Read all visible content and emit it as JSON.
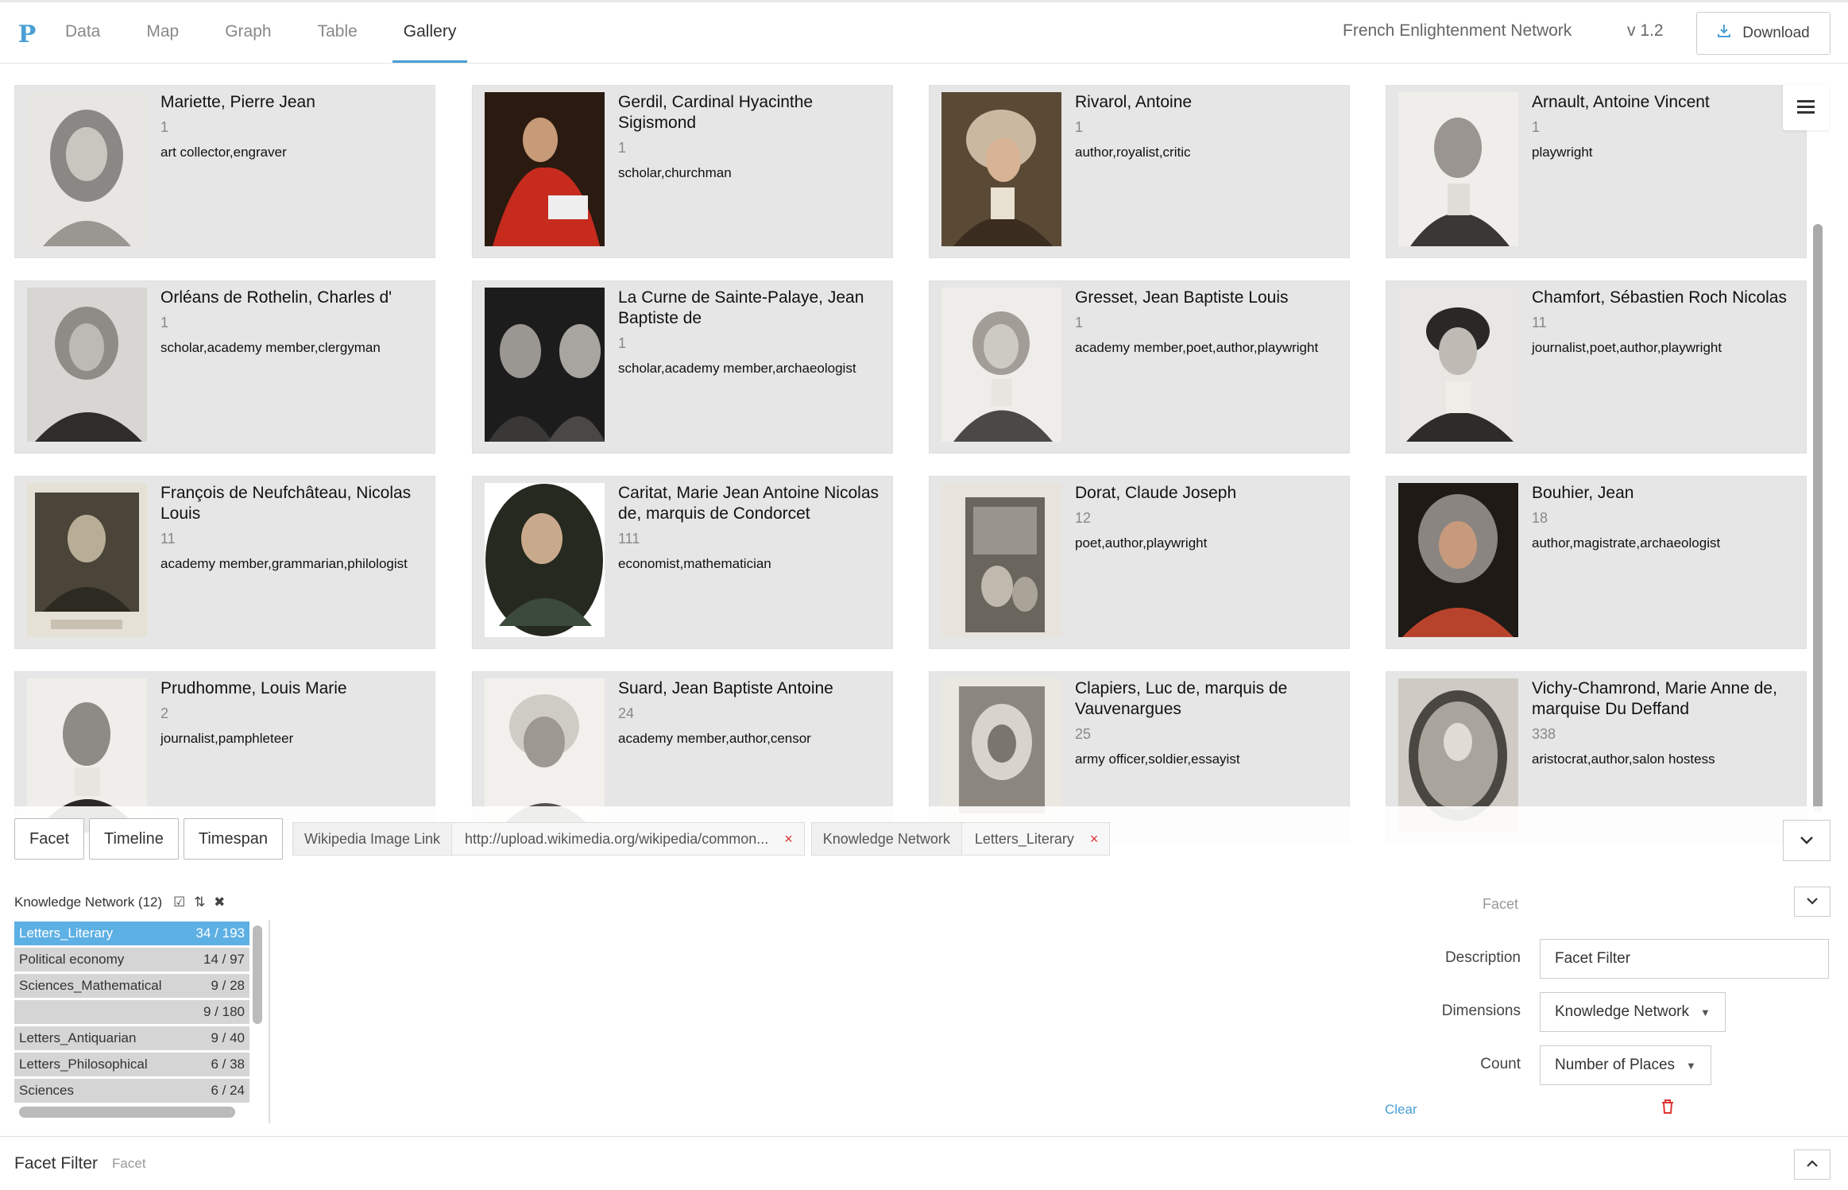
{
  "app": {
    "logo": "P",
    "title": "French Enlightenment Network",
    "version": "v 1.2",
    "download_label": "Download"
  },
  "nav": {
    "tabs": [
      {
        "label": "Data"
      },
      {
        "label": "Map"
      },
      {
        "label": "Graph"
      },
      {
        "label": "Table"
      },
      {
        "label": "Gallery"
      }
    ],
    "active": "Gallery"
  },
  "gallery": {
    "cards": [
      {
        "name": "Mariette, Pierre Jean",
        "count": "1",
        "roles": "art collector,engraver"
      },
      {
        "name": "Gerdil, Cardinal Hyacinthe Sigismond",
        "count": "1",
        "roles": "scholar,churchman"
      },
      {
        "name": "Rivarol, Antoine",
        "count": "1",
        "roles": "author,royalist,critic"
      },
      {
        "name": "Arnault, Antoine Vincent",
        "count": "1",
        "roles": "playwright"
      },
      {
        "name": "Orléans de Rothelin, Charles d'",
        "count": "1",
        "roles": "scholar,academy member,clergyman"
      },
      {
        "name": "La Curne de Sainte-Palaye, Jean Baptiste de",
        "count": "1",
        "roles": "scholar,academy member,archaeologist"
      },
      {
        "name": "Gresset, Jean Baptiste Louis",
        "count": "1",
        "roles": "academy member,poet,author,playwright"
      },
      {
        "name": "Chamfort, Sébastien Roch Nicolas",
        "count": "11",
        "roles": "journalist,poet,author,playwright"
      },
      {
        "name": "François de Neufchâteau, Nicolas Louis",
        "count": "11",
        "roles": "academy member,grammarian,philologist"
      },
      {
        "name": "Caritat, Marie Jean Antoine Nicolas de, marquis de Condorcet",
        "count": "111",
        "roles": "economist,mathematician"
      },
      {
        "name": "Dorat, Claude Joseph",
        "count": "12",
        "roles": "poet,author,playwright"
      },
      {
        "name": "Bouhier, Jean",
        "count": "18",
        "roles": "author,magistrate,archaeologist"
      },
      {
        "name": "Prudhomme, Louis Marie",
        "count": "2",
        "roles": "journalist,pamphleteer"
      },
      {
        "name": "Suard, Jean Baptiste Antoine",
        "count": "24",
        "roles": "academy member,author,censor"
      },
      {
        "name": "Clapiers, Luc de, marquis de Vauvenargues",
        "count": "25",
        "roles": "army officer,soldier,essayist"
      },
      {
        "name": "Vichy-Chamrond, Marie Anne de, marquise Du Deffand",
        "count": "338",
        "roles": "aristocrat,author,salon hostess"
      }
    ]
  },
  "filters": {
    "buttons": [
      {
        "label": "Facet"
      },
      {
        "label": "Timeline"
      },
      {
        "label": "Timespan"
      }
    ],
    "chips": [
      {
        "key": "Wikipedia Image Link",
        "value": "http://upload.wikimedia.org/wikipedia/common...",
        "remove": "×"
      },
      {
        "key": "Knowledge Network",
        "value": "Letters_Literary",
        "remove": "×"
      }
    ]
  },
  "facet_panel": {
    "header": "Knowledge Network (12)",
    "tools": "☑ ⇅ ✖",
    "rows": [
      {
        "label": "Letters_Literary",
        "count": "34 / 193",
        "selected": true
      },
      {
        "label": "Political economy",
        "count": "14 / 97",
        "selected": false
      },
      {
        "label": "Sciences_Mathematical",
        "count": "9 / 28",
        "selected": false
      },
      {
        "label": "",
        "count": "9 / 180",
        "selected": false
      },
      {
        "label": "Letters_Antiquarian",
        "count": "9 / 40",
        "selected": false
      },
      {
        "label": "Letters_Philosophical",
        "count": "6 / 38",
        "selected": false
      },
      {
        "label": "Sciences",
        "count": "6 / 24",
        "selected": false
      }
    ]
  },
  "settings": {
    "type_label": "Facet",
    "description_label": "Description",
    "description_value": "Facet Filter",
    "dimensions_label": "Dimensions",
    "dimensions_value": "Knowledge Network",
    "count_label": "Count",
    "count_value": "Number of Places",
    "clear_label": "Clear"
  },
  "bottom": {
    "title": "Facet Filter",
    "subtitle": "Facet"
  }
}
